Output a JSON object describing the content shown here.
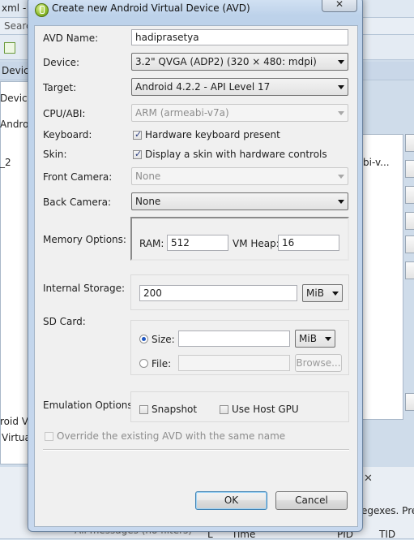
{
  "background": {
    "title_fragment": "xml - A",
    "search_fragment": "Searc",
    "devices_tab_fragment": "Devic",
    "devices_fragment": "Devices",
    "android_fragment": "Androi",
    "row_fragment": "_2",
    "abi_fragment": "bi-v...",
    "android_virt_fragment": "roid Vi",
    "virtua_fragment": "Virtua",
    "regex_fragment": "egexes. Prefi",
    "all_messages_fragment": "All messages (no filters)",
    "col_l": "L",
    "col_time": "Time",
    "col_pid": "PID",
    "col_tid": "TID"
  },
  "dialog": {
    "title": "Create new Android Virtual Device (AVD)",
    "close_label": "✕",
    "fields": {
      "avd_name_label": "AVD Name:",
      "avd_name_value": "hadiprasetya",
      "device_label": "Device:",
      "device_value": "3.2\" QVGA (ADP2) (320 × 480: mdpi)",
      "target_label": "Target:",
      "target_value": "Android 4.2.2 - API Level 17",
      "cpu_label": "CPU/ABI:",
      "cpu_value": "ARM (armeabi-v7a)",
      "keyboard_label": "Keyboard:",
      "keyboard_check_label": "Hardware keyboard present",
      "skin_label": "Skin:",
      "skin_check_label": "Display a skin with hardware controls",
      "front_camera_label": "Front Camera:",
      "front_camera_value": "None",
      "back_camera_label": "Back Camera:",
      "back_camera_value": "None",
      "memory_label": "Memory Options:",
      "ram_label": "RAM:",
      "ram_value": "512",
      "vm_heap_label": "VM Heap:",
      "vm_heap_value": "16",
      "internal_storage_label": "Internal Storage:",
      "internal_storage_value": "200",
      "internal_storage_unit": "MiB",
      "sd_card_label": "SD Card:",
      "sd_size_label": "Size:",
      "sd_size_value": "",
      "sd_size_unit": "MiB",
      "sd_file_label": "File:",
      "sd_file_value": "",
      "browse_label": "Browse...",
      "emulation_label": "Emulation Options:",
      "snapshot_label": "Snapshot",
      "use_host_gpu_label": "Use Host GPU",
      "override_label": "Override the existing AVD with the same name"
    },
    "buttons": {
      "ok": "OK",
      "cancel": "Cancel"
    }
  },
  "colors": {
    "accent": "#3c7fb1",
    "radio_selected": "#1f57c1"
  }
}
